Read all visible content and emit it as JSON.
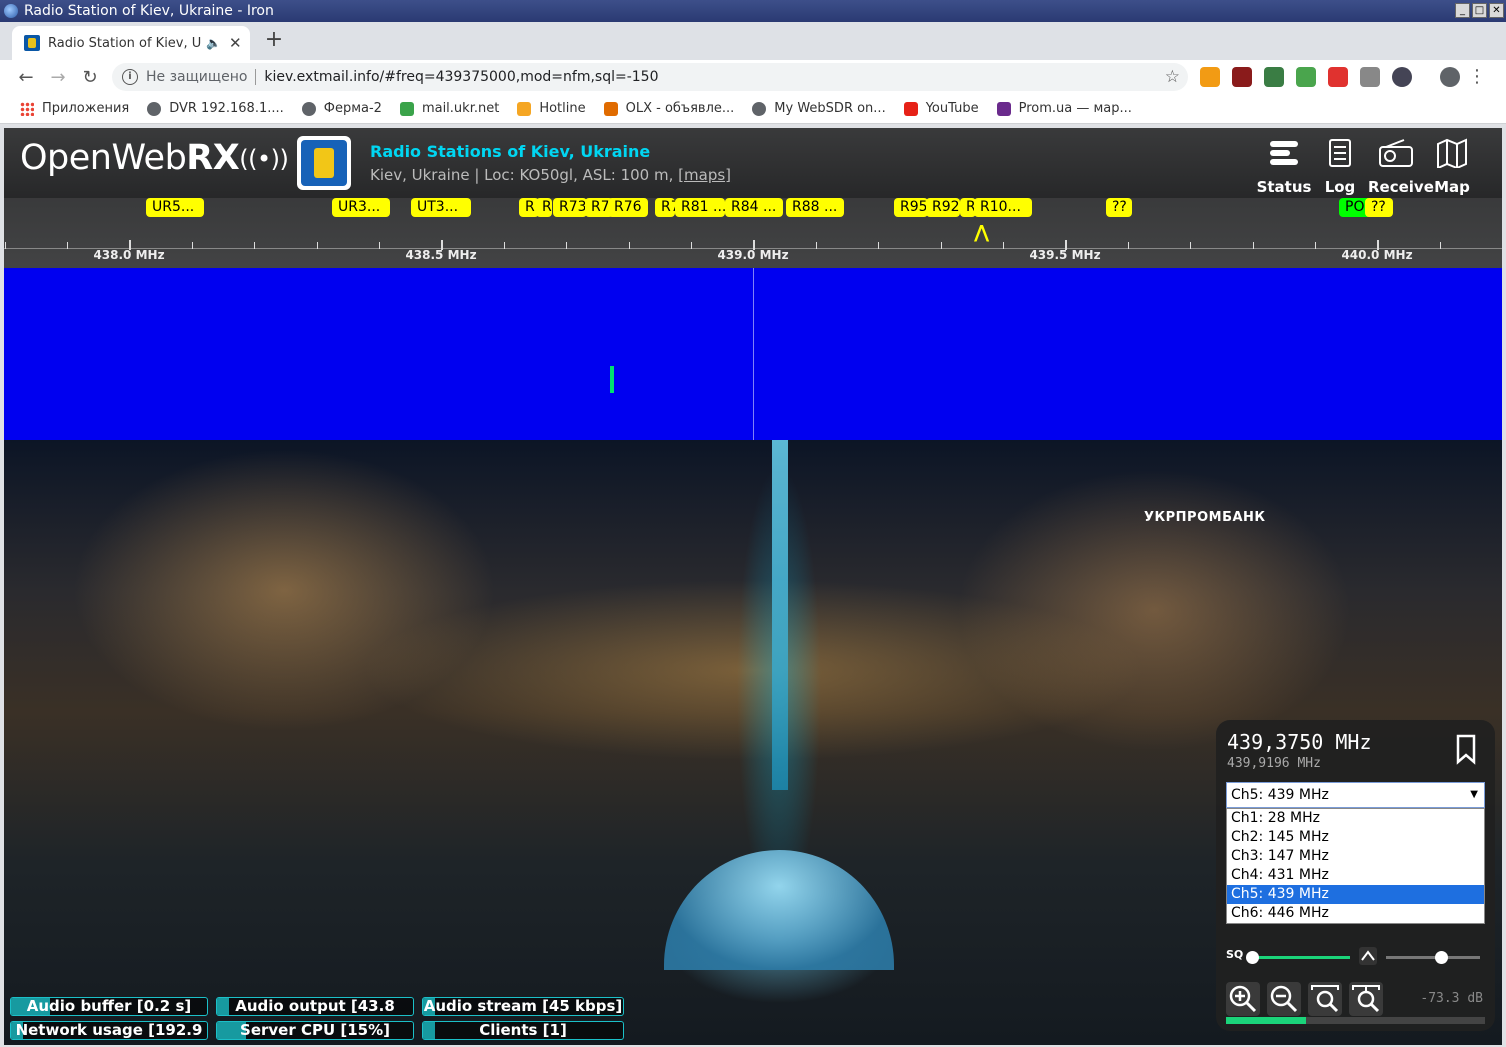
{
  "window": {
    "title": "Radio Station of Kiev, Ukraine - Iron"
  },
  "browser": {
    "tab_title": "Radio Station of Kiev, U",
    "url_security": "Не защищено",
    "url": "kiev.extmail.info/#freq=439375000,mod=nfm,sql=-150",
    "bookmarks": [
      {
        "label": "Приложения",
        "icon": "apps-icon",
        "color": "#ea4335"
      },
      {
        "label": "DVR 192.168.1....",
        "icon": "globe-icon",
        "color": "#5f6368"
      },
      {
        "label": "Ферма-2",
        "icon": "globe-icon",
        "color": "#5f6368"
      },
      {
        "label": "mail.ukr.net",
        "icon": "mail-icon",
        "color": "#3aa34a"
      },
      {
        "label": "Hotline",
        "icon": "hotline-icon",
        "color": "#f5a623"
      },
      {
        "label": "OLX - объявле...",
        "icon": "olx-icon",
        "color": "#e06b00"
      },
      {
        "label": "My WebSDR on...",
        "icon": "globe-icon",
        "color": "#5f6368"
      },
      {
        "label": "YouTube",
        "icon": "youtube-icon",
        "color": "#e62117"
      },
      {
        "label": "Prom.ua — мар...",
        "icon": "prom-icon",
        "color": "#6a2a8c"
      }
    ]
  },
  "header": {
    "logo_text": "OpenWeb",
    "logo_bold": "RX",
    "receiver_name": "Radio Stations of Kiev, Ukraine",
    "receiver_desc": "Kiev, Ukraine | Loc: KO50gl, ASL: 100 m,",
    "maps_link": "[maps]",
    "buttons": [
      {
        "label": "Status",
        "icon": "status-icon"
      },
      {
        "label": "Log",
        "icon": "log-icon"
      },
      {
        "label": "Receive",
        "icon": "radio-icon"
      },
      {
        "label": "Map",
        "icon": "map-icon"
      }
    ]
  },
  "scale": {
    "freq_labels": [
      "438.0 MHz",
      "438.5 MHz",
      "439.0 MHz",
      "439.5 MHz",
      "440.0 MHz"
    ],
    "bookmarks": [
      {
        "label": "UR5...",
        "color": "#ffff00"
      },
      {
        "label": "UR3...",
        "color": "#ffff00"
      },
      {
        "label": "UT3...",
        "color": "#ffff00"
      },
      {
        "label": "R",
        "color": "#ffff00"
      },
      {
        "label": "R",
        "color": "#ffff00"
      },
      {
        "label": "R73",
        "color": "#ffff00"
      },
      {
        "label": "R7",
        "color": "#ffff00"
      },
      {
        "label": "R76",
        "color": "#ffff00"
      },
      {
        "label": "R7",
        "color": "#ffff00"
      },
      {
        "label": "R81 ...",
        "color": "#ffff00"
      },
      {
        "label": "R84 ...",
        "color": "#ffff00"
      },
      {
        "label": "R88 ...",
        "color": "#ffff00"
      },
      {
        "label": "R95",
        "color": "#ffff00"
      },
      {
        "label": "R92",
        "color": "#ffff00"
      },
      {
        "label": "R",
        "color": "#ffff00"
      },
      {
        "label": "R10...",
        "color": "#ffff00"
      },
      {
        "label": "??",
        "color": "#ffff00"
      },
      {
        "label": "PO",
        "color": "#00ff00"
      },
      {
        "label": "??",
        "color": "#ffff00"
      }
    ]
  },
  "status_bars": [
    {
      "label": "Audio buffer [0.2 s]",
      "fill": 0.2
    },
    {
      "label": "Audio output [43.8",
      "fill": 0.05
    },
    {
      "label": "Audio stream [45 kbps]",
      "fill": 0.0
    },
    {
      "label": "Network usage [192.9",
      "fill": 0.02
    },
    {
      "label": "Server CPU [15%]",
      "fill": 0.15
    },
    {
      "label": "Clients [1]",
      "fill": 0.0
    }
  ],
  "receiver": {
    "frequency": "439,3750 MHz",
    "sub_frequency": "439,9196 MHz",
    "profile_selected": "Ch5: 439 MHz",
    "profiles": [
      "Ch1: 28 MHz",
      "Ch2: 145 MHz",
      "Ch3: 147 MHz",
      "Ch4: 431 MHz",
      "Ch5: 439 MHz",
      "Ch6: 446 MHz"
    ],
    "selected_index": 4,
    "squelch_label": "SQ",
    "db_value": "-73.3 dB",
    "squelch_level": 0.0,
    "gain_level": 0.58,
    "smeter_level": 0.31
  },
  "colors": {
    "accent": "#00d6f2",
    "waterfall": "#0000f0",
    "status_border": "#1bc0c8",
    "smeter": "#1bd47a"
  },
  "background": {
    "sign": "УКРПРОМБАНК"
  }
}
